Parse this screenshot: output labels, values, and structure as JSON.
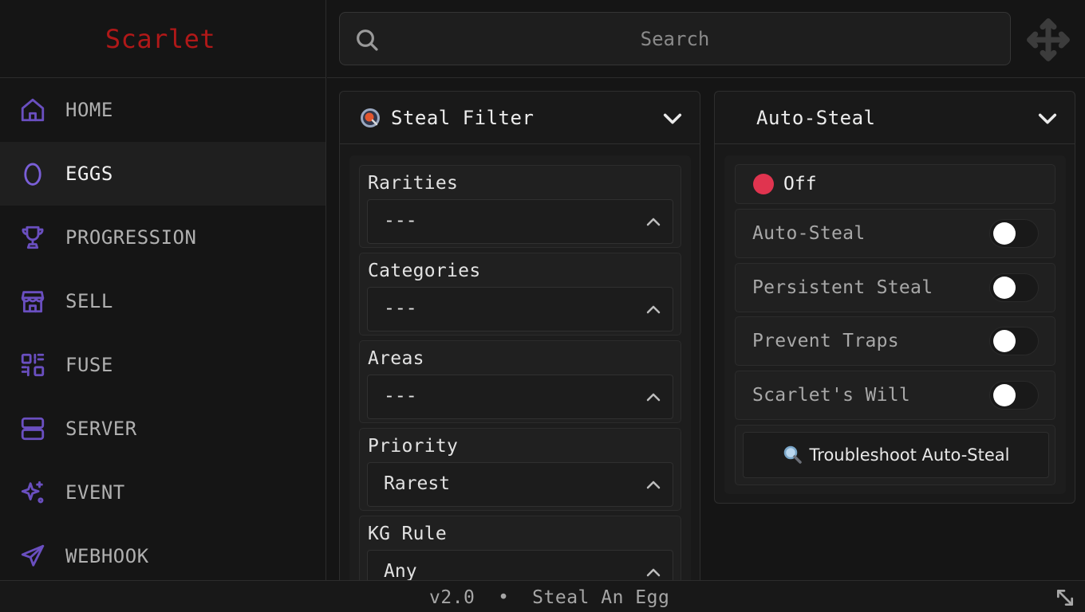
{
  "app": {
    "title": "Scarlet",
    "brand_color": "#b01818",
    "accent_color": "#6a4fc0"
  },
  "sidebar": {
    "items": [
      {
        "label": "HOME",
        "icon": "home-icon",
        "active": false
      },
      {
        "label": "EGGS",
        "icon": "egg-icon",
        "active": true
      },
      {
        "label": "PROGRESSION",
        "icon": "trophy-icon",
        "active": false
      },
      {
        "label": "SELL",
        "icon": "store-icon",
        "active": false
      },
      {
        "label": "FUSE",
        "icon": "fuse-icon",
        "active": false
      },
      {
        "label": "SERVER",
        "icon": "server-icon",
        "active": false
      },
      {
        "label": "EVENT",
        "icon": "sparkles-icon",
        "active": false
      },
      {
        "label": "WEBHOOK",
        "icon": "send-icon",
        "active": false
      }
    ]
  },
  "search": {
    "placeholder": "Search",
    "icon": "search-icon"
  },
  "steal_filter": {
    "title": "Steal Filter",
    "icon": "steal-filter-icon",
    "fields": [
      {
        "label": "Rarities",
        "value": "---"
      },
      {
        "label": "Categories",
        "value": "---"
      },
      {
        "label": "Areas",
        "value": "---"
      },
      {
        "label": "Priority",
        "value": "Rarest"
      },
      {
        "label": "KG Rule",
        "value": "Any"
      }
    ]
  },
  "auto_steal": {
    "title": "Auto-Steal",
    "status": {
      "text": "Off",
      "color": "#e0344f"
    },
    "toggles": [
      {
        "label": "Auto-Steal",
        "on": false
      },
      {
        "label": "Persistent Steal",
        "on": false
      },
      {
        "label": "Prevent Traps",
        "on": false
      },
      {
        "label": "Scarlet's Will",
        "on": false
      }
    ],
    "troubleshoot_label": "Troubleshoot Auto-Steal",
    "troubleshoot_icon": "magnifier-icon"
  },
  "footer": {
    "version": "v2.0",
    "separator": "•",
    "game": "Steal An Egg"
  }
}
